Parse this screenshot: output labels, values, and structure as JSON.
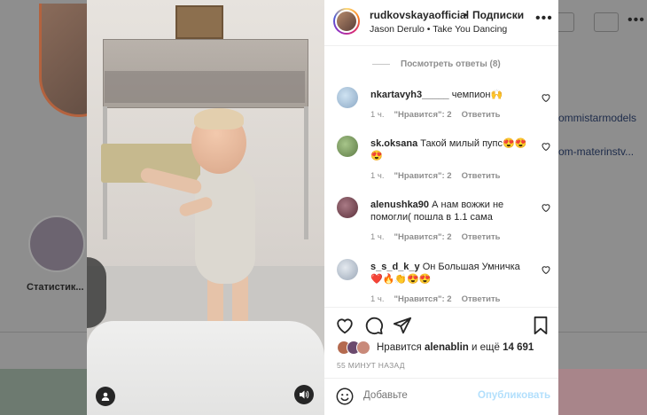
{
  "background": {
    "highlight_label": "Статистик...",
    "right_text_1": "ommistarmodels",
    "right_text_2": "om-materinstv..."
  },
  "post": {
    "username": "rudkovskayaofficial",
    "dot": "•",
    "follow_label": "Подписки",
    "song": "Jason Derulo • Take You Dancing"
  },
  "replies_label": "Посмотреть ответы (8)",
  "comments": [
    {
      "user": "nkartavyh3_____",
      "text": "чемпион🙌",
      "time": "1 ч.",
      "likes": "\"Нравится\": 2",
      "reply": "Ответить",
      "avatar_color": "#9fb5c9"
    },
    {
      "user": "sk.oksana",
      "text": "Такой милый пупс😍😍😍",
      "time": "1 ч.",
      "likes": "\"Нравится\": 2",
      "reply": "Ответить",
      "avatar_color": "#7d9a5e"
    },
    {
      "user": "alenushka90",
      "text": "А нам вожжи не помогли( пошла в 1.1 сама",
      "time": "1 ч.",
      "likes": "\"Нравится\": 2",
      "reply": "Ответить",
      "avatar_color": "#7a4a55"
    },
    {
      "user": "s_s_d_k_y",
      "text": "Он Большая Умничка ❤️🔥👏😍😍",
      "time": "1 ч.",
      "likes": "\"Нравится\": 2",
      "reply": "Ответить",
      "avatar_color": "#b8c2cf"
    }
  ],
  "likes": {
    "prefix": "Нравится",
    "user": "alenablin",
    "middle": "и ещё",
    "count": "14 691"
  },
  "time_ago": "55 МИНУТ НАЗАД",
  "comment_input": {
    "placeholder": "Добавьте"
  },
  "publish_label": "Опубликовать",
  "colors": {
    "link_disabled": "#b2dffc",
    "text": "#262626",
    "muted": "#8e8e8e"
  }
}
